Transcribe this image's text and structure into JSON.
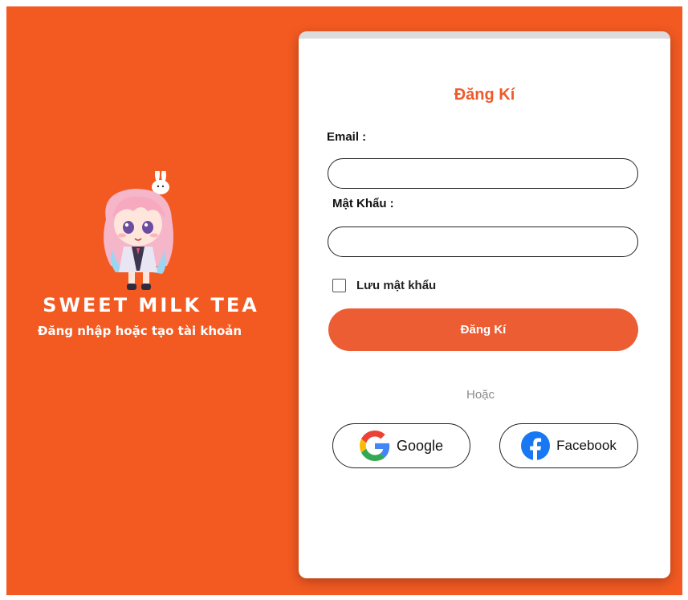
{
  "brand": {
    "title": "SWEET MILK TEA",
    "subtitle": "Đăng nhập hoặc tạo tài khoản",
    "accent_color": "#f35a22",
    "mascot_icon": "chibi-girl-mascot-icon"
  },
  "form": {
    "title": "Đăng Kí",
    "email_label": "Email :",
    "email_value": "",
    "email_placeholder": "",
    "password_label": "Mật Khẩu :",
    "password_value": "",
    "password_placeholder": "",
    "remember_label": "Lưu mật khẩu",
    "remember_checked": false,
    "submit_label": "Đăng Kí",
    "submit_color": "#ec5d34",
    "divider_text": "Hoặc"
  },
  "social": {
    "google_label": "Google",
    "google_icon": "google-icon",
    "facebook_label": "Facebook",
    "facebook_icon": "facebook-icon",
    "facebook_color": "#1877f2"
  }
}
